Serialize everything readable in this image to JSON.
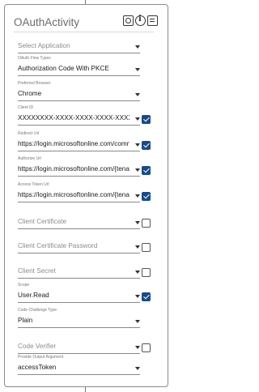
{
  "title": "OAuthActivity",
  "title_icons": [
    "gear-icon",
    "info-icon",
    "comment-icon"
  ],
  "fields": [
    {
      "key": "select_application",
      "label": "",
      "value": "Select Application",
      "placeholder": true,
      "checkbox": null
    },
    {
      "key": "oauth_flow_types",
      "label": "OAuth Flow Types",
      "value": "Authorization Code With PKCE",
      "placeholder": false,
      "checkbox": null
    },
    {
      "key": "preferred_browser",
      "label": "Preferred Browser",
      "value": "Chrome",
      "placeholder": false,
      "checkbox": null
    },
    {
      "key": "client_id",
      "label": "Client ID",
      "value": "XXXXXXXX-XXXX-XXXX-XXXX-XXXXXXXX",
      "placeholder": false,
      "checkbox": true
    },
    {
      "key": "redirect_url",
      "label": "Redirect Url",
      "value": "https://login.microsoftonline.com/comn",
      "placeholder": false,
      "checkbox": true
    },
    {
      "key": "authorize_url",
      "label": "Authorize Url",
      "value": "https://login.microsoftonline.com/{tena",
      "placeholder": false,
      "checkbox": true
    },
    {
      "key": "access_token_url",
      "label": "Access Token Url",
      "value": "https://login.microsoftonline.com/{tena",
      "placeholder": false,
      "checkbox": true
    },
    {
      "key": "client_certificate",
      "label": "",
      "value": "Client Certificate",
      "placeholder": true,
      "checkbox": false
    },
    {
      "key": "client_certificate_password",
      "label": "",
      "value": "Client Certificate Password",
      "placeholder": true,
      "checkbox": false
    },
    {
      "key": "client_secret",
      "label": "",
      "value": "Client Secret",
      "placeholder": true,
      "checkbox": false
    },
    {
      "key": "scope",
      "label": "Scope",
      "value": "User.Read",
      "placeholder": false,
      "checkbox": true
    },
    {
      "key": "code_challenge_type",
      "label": "Code Challenge Type",
      "value": "Plain",
      "placeholder": false,
      "checkbox": null
    },
    {
      "key": "code_verifier",
      "label": "",
      "value": "Code Verifier",
      "placeholder": true,
      "checkbox": false
    },
    {
      "key": "provide_output_argument",
      "label": "Provide Output Argument",
      "value": "accessToken",
      "placeholder": false,
      "checkbox": null
    }
  ]
}
